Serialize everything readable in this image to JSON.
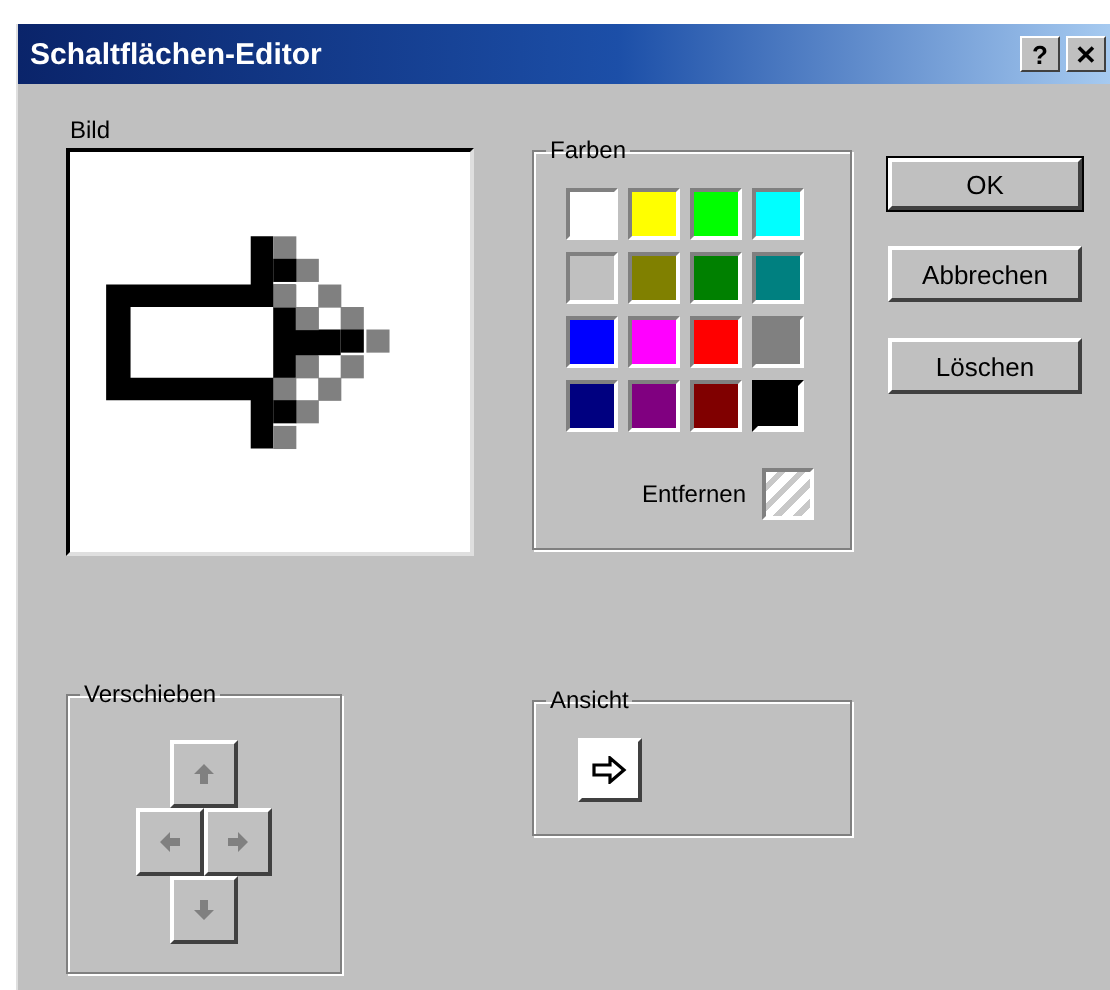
{
  "window": {
    "title": "Schaltflächen-Editor",
    "title_buttons": [
      "?",
      "✕"
    ]
  },
  "image": {
    "label": "Bild"
  },
  "colors": {
    "label": "Farben",
    "swatches": [
      {
        "color": "#ffffff",
        "selected": false
      },
      {
        "color": "#ffff00",
        "selected": false
      },
      {
        "color": "#00ff00",
        "selected": false
      },
      {
        "color": "#00ffff",
        "selected": false
      },
      {
        "color": "#c0c0c0",
        "selected": false
      },
      {
        "color": "#808000",
        "selected": false
      },
      {
        "color": "#008000",
        "selected": false
      },
      {
        "color": "#008080",
        "selected": false
      },
      {
        "color": "#0000ff",
        "selected": false
      },
      {
        "color": "#ff00ff",
        "selected": false
      },
      {
        "color": "#ff0000",
        "selected": false
      },
      {
        "color": "#808080",
        "selected": false
      },
      {
        "color": "#000080",
        "selected": false
      },
      {
        "color": "#800080",
        "selected": false
      },
      {
        "color": "#800000",
        "selected": false
      },
      {
        "color": "#000000",
        "selected": true
      }
    ],
    "remove_label": "Entfernen"
  },
  "move": {
    "label": "Verschieben"
  },
  "preview": {
    "label": "Ansicht"
  },
  "buttons": [
    {
      "label": "OK",
      "default": true
    },
    {
      "label": "Abbrechen",
      "default": false
    },
    {
      "label": "Löschen",
      "default": false
    }
  ]
}
